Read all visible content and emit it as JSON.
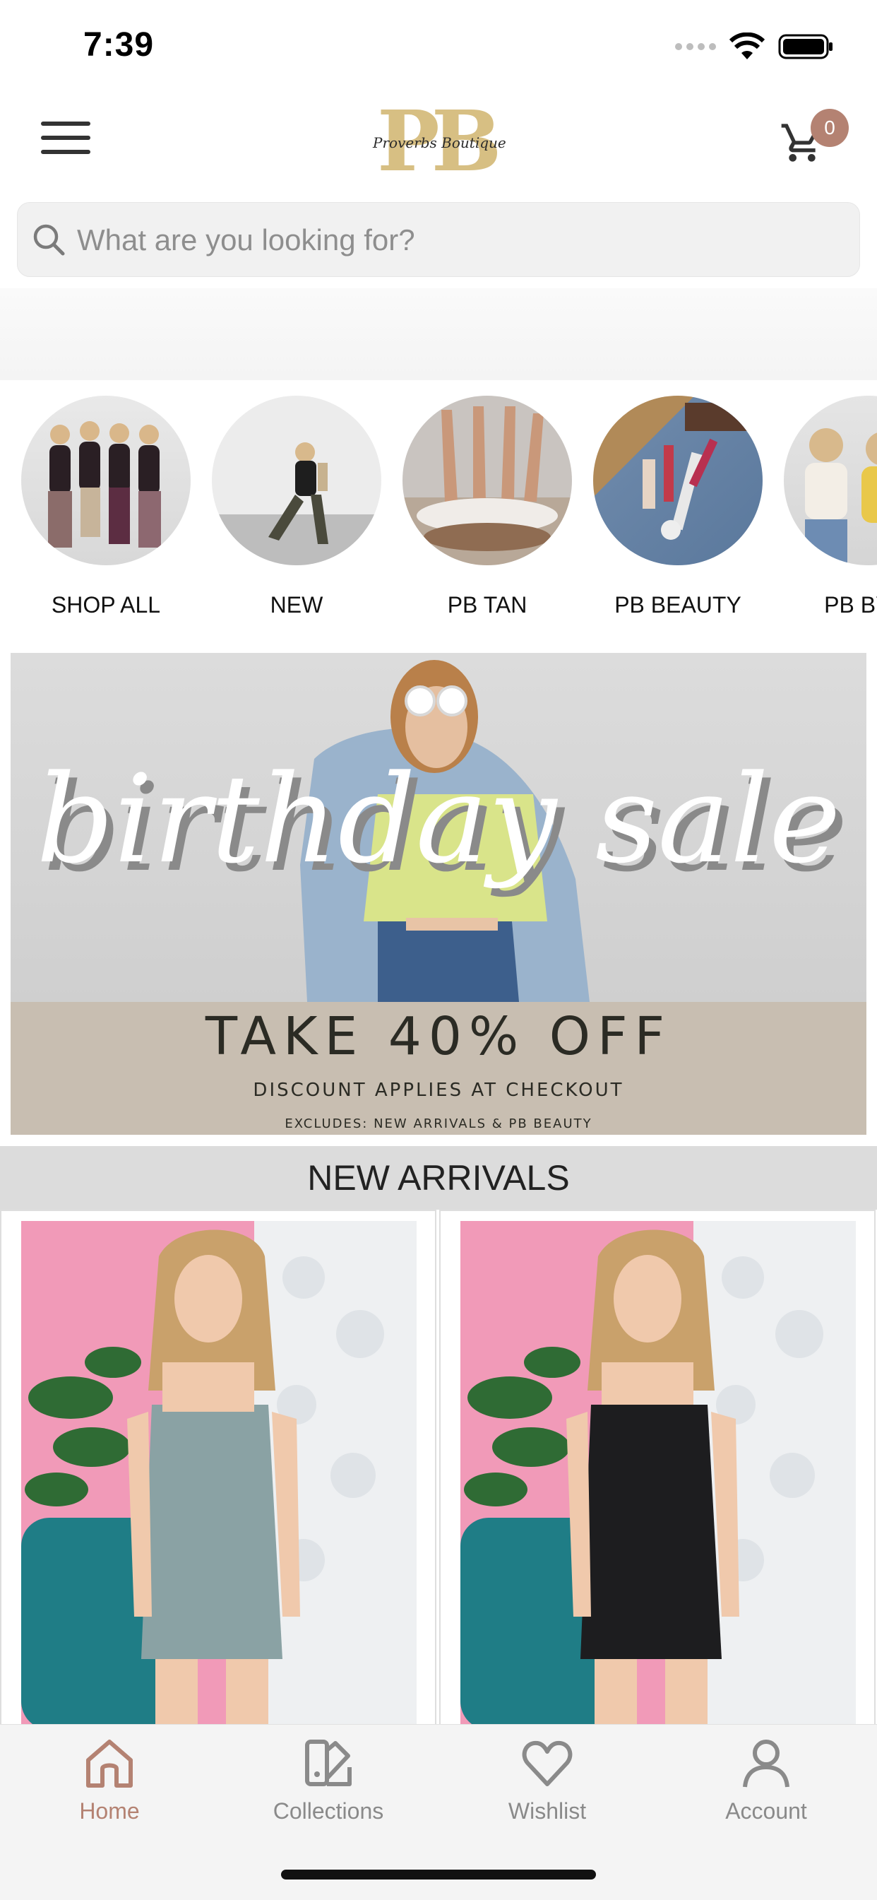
{
  "status_bar": {
    "time": "7:39"
  },
  "header": {
    "logo_text": "PB",
    "logo_script": "Proverbs Boutique",
    "cart_count": "0"
  },
  "search": {
    "placeholder": "What are you looking for?"
  },
  "categories": [
    {
      "label": "SHOP ALL"
    },
    {
      "label": "NEW"
    },
    {
      "label": "PB TAN"
    },
    {
      "label": "PB BEAUTY"
    },
    {
      "label": "PB BY D"
    }
  ],
  "banner": {
    "title": "birthday sale",
    "offer": "TAKE 40% OFF",
    "note": "DISCOUNT APPLIES AT CHECKOUT",
    "exclusions": "EXCLUDES: NEW ARRIVALS & PB BEAUTY"
  },
  "new_arrivals": {
    "title": "NEW ARRIVALS"
  },
  "tab_bar": {
    "tabs": [
      {
        "label": "Home",
        "icon": "home-icon",
        "active": true
      },
      {
        "label": "Collections",
        "icon": "collections-icon",
        "active": false
      },
      {
        "label": "Wishlist",
        "icon": "heart-icon",
        "active": false
      },
      {
        "label": "Account",
        "icon": "person-icon",
        "active": false
      }
    ]
  },
  "colors": {
    "accent": "#b48272",
    "logo_gold": "#d7bf83",
    "banner_band": "#c8beb1",
    "inactive_tab": "#8a8a8a"
  }
}
